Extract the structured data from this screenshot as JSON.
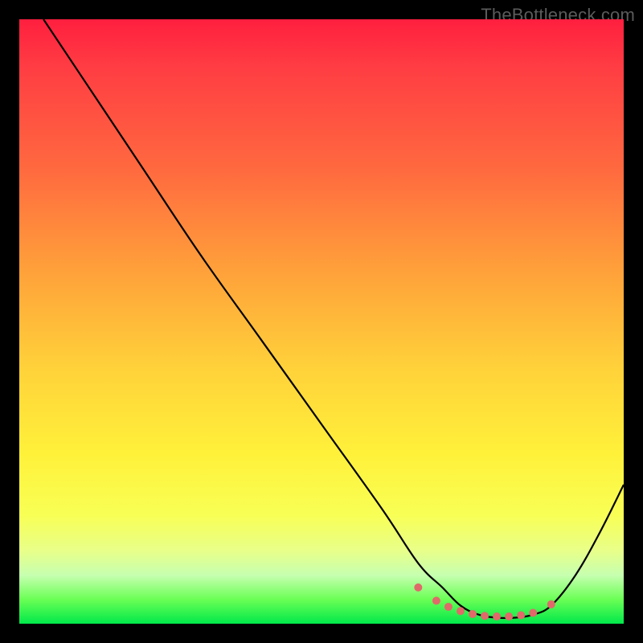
{
  "watermark": "TheBottleneck.com",
  "chart_data": {
    "type": "line",
    "title": "",
    "xlabel": "",
    "ylabel": "",
    "xlim": [
      0,
      100
    ],
    "ylim": [
      0,
      100
    ],
    "grid": false,
    "series": [
      {
        "name": "bottleneck-curve",
        "x": [
          4,
          10,
          20,
          30,
          40,
          50,
          60,
          66,
          70,
          73,
          76,
          79,
          82,
          85,
          88,
          92,
          96,
          100
        ],
        "y": [
          100,
          91,
          76,
          61,
          47,
          33,
          19,
          10,
          6,
          3,
          1.5,
          1,
          1,
          1.5,
          3,
          8,
          15,
          23
        ]
      }
    ],
    "markers": {
      "name": "flat-region-dots",
      "color": "#e06a6a",
      "radius": 5,
      "x": [
        66,
        69,
        71,
        73,
        75,
        77,
        79,
        81,
        83,
        85,
        88
      ],
      "y": [
        6,
        3.8,
        2.8,
        2.1,
        1.6,
        1.3,
        1.2,
        1.2,
        1.4,
        1.8,
        3.2
      ]
    }
  },
  "colors": {
    "curve": "#000000",
    "marker": "#e06a6a",
    "bg_top": "#ff1f3f",
    "bg_bottom": "#00e84a"
  }
}
